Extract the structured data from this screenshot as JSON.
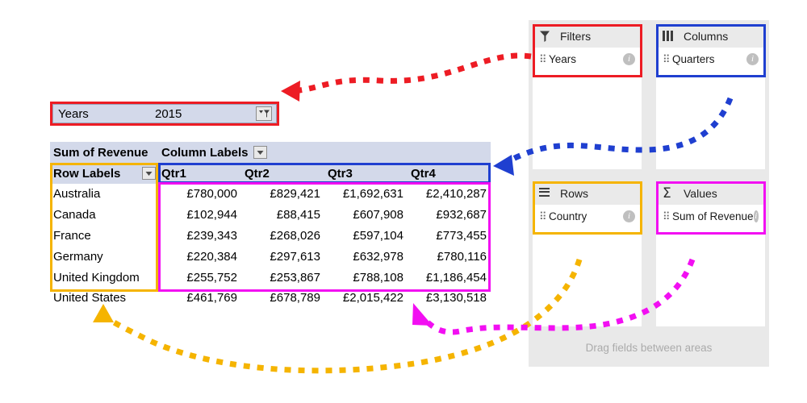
{
  "slicer": {
    "label": "Years",
    "value": "2015",
    "button_icon": "filter-dropdown-icon"
  },
  "pivot": {
    "corner_label": "Sum of Revenue",
    "column_labels_header": "Column Labels",
    "row_labels_header": "Row Labels",
    "column_headers": [
      "Qtr1",
      "Qtr2",
      "Qtr3",
      "Qtr4"
    ],
    "rows": [
      {
        "country": "Australia",
        "values": [
          "£780,000",
          "£829,421",
          "£1,692,631",
          "£2,410,287"
        ]
      },
      {
        "country": "Canada",
        "values": [
          "£102,944",
          "£88,415",
          "£607,908",
          "£932,687"
        ]
      },
      {
        "country": "France",
        "values": [
          "£239,343",
          "£268,026",
          "£597,104",
          "£773,455"
        ]
      },
      {
        "country": "Germany",
        "values": [
          "£220,384",
          "£297,613",
          "£632,978",
          "£780,116"
        ]
      },
      {
        "country": "United Kingdom",
        "values": [
          "£255,752",
          "£253,867",
          "£788,108",
          "£1,186,454"
        ]
      },
      {
        "country": "United States",
        "values": [
          "£461,769",
          "£678,789",
          "£2,015,422",
          "£3,130,518"
        ]
      }
    ]
  },
  "field_list": {
    "zones": [
      {
        "title": "Filters",
        "icon": "funnel-icon",
        "field": "Years",
        "accent": "#ED1C24"
      },
      {
        "title": "Columns",
        "icon": "columns-icon",
        "field": "Quarters",
        "accent": "#1F3FD0"
      },
      {
        "title": "Rows",
        "icon": "hamburger-icon",
        "field": "Country",
        "accent": "#F5B400"
      },
      {
        "title": "Values",
        "icon": "sigma-icon",
        "field": "Sum of Revenue",
        "accent": "#F20FF2"
      }
    ],
    "drag_hint": "Drag fields between areas"
  },
  "connectors": [
    {
      "name": "filters-to-slicer",
      "color": "#ED1C24"
    },
    {
      "name": "columns-to-colheaders",
      "color": "#1F3FD0"
    },
    {
      "name": "rows-to-rowlabels",
      "color": "#F5B400"
    },
    {
      "name": "values-to-databody",
      "color": "#F20FF2"
    }
  ]
}
